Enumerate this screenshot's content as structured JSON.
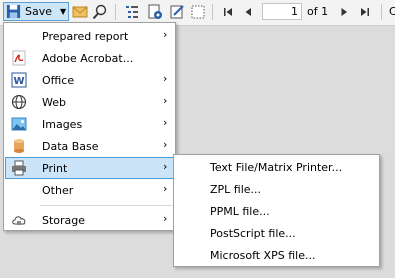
{
  "toolbar": {
    "save_label": "Save",
    "page_value": "1",
    "of_label": "of 1",
    "clipped_label": "C"
  },
  "save_menu": {
    "items": [
      {
        "label": "Prepared report",
        "icon": "none"
      },
      {
        "label": "Adobe Acrobat...",
        "icon": "pdf-icon"
      },
      {
        "label": "Office",
        "icon": "word-icon"
      },
      {
        "label": "Web",
        "icon": "globe-icon"
      },
      {
        "label": "Images",
        "icon": "image-icon"
      },
      {
        "label": "Data Base",
        "icon": "database-icon"
      },
      {
        "label": "Print",
        "icon": "printer-icon",
        "selected": true
      },
      {
        "label": "Other",
        "icon": "none"
      },
      {
        "label": "Storage",
        "icon": "cloud-icon"
      }
    ]
  },
  "print_submenu": {
    "items": [
      "Text File/Matrix Printer...",
      "ZPL file...",
      "PPML file...",
      "PostScript file...",
      "Microsoft XPS file..."
    ]
  },
  "colors": {
    "selection_bg": "#cce4f7",
    "selection_border": "#4a9bd9",
    "pdf_red": "#d9251c",
    "word_blue": "#2b579a"
  }
}
